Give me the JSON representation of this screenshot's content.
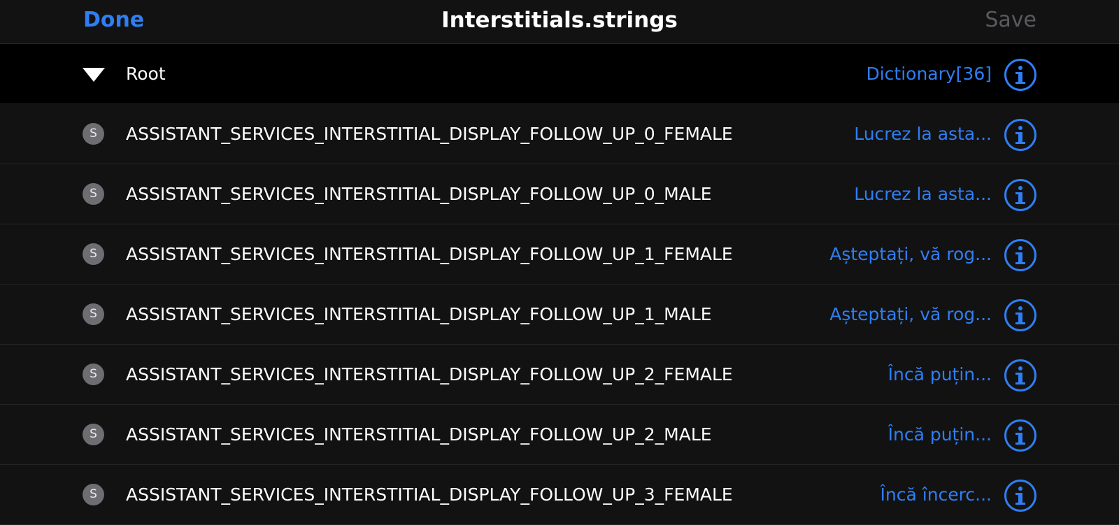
{
  "navbar": {
    "done_label": "Done",
    "title": "Interstitials.strings",
    "save_label": "Save"
  },
  "root": {
    "key": "Root",
    "value": "Dictionary[36]"
  },
  "rows": [
    {
      "type_badge": "S",
      "key": "ASSISTANT_SERVICES_INTERSTITIAL_DISPLAY_FOLLOW_UP_0_FEMALE",
      "value": "Lucrez la asta..."
    },
    {
      "type_badge": "S",
      "key": "ASSISTANT_SERVICES_INTERSTITIAL_DISPLAY_FOLLOW_UP_0_MALE",
      "value": "Lucrez la asta..."
    },
    {
      "type_badge": "S",
      "key": "ASSISTANT_SERVICES_INTERSTITIAL_DISPLAY_FOLLOW_UP_1_FEMALE",
      "value": "Așteptați, vă rog..."
    },
    {
      "type_badge": "S",
      "key": "ASSISTANT_SERVICES_INTERSTITIAL_DISPLAY_FOLLOW_UP_1_MALE",
      "value": "Așteptați, vă rog..."
    },
    {
      "type_badge": "S",
      "key": "ASSISTANT_SERVICES_INTERSTITIAL_DISPLAY_FOLLOW_UP_2_FEMALE",
      "value": "Încă puțin..."
    },
    {
      "type_badge": "S",
      "key": "ASSISTANT_SERVICES_INTERSTITIAL_DISPLAY_FOLLOW_UP_2_MALE",
      "value": "Încă puțin..."
    },
    {
      "type_badge": "S",
      "key": "ASSISTANT_SERVICES_INTERSTITIAL_DISPLAY_FOLLOW_UP_3_FEMALE",
      "value": "Încă încerc..."
    }
  ],
  "colors": {
    "accent": "#2f7ef3",
    "background": "#121213",
    "root_background": "#000000",
    "disabled_text": "#5a5a5e",
    "badge": "#6e6e72"
  },
  "icons": {
    "disclosure": "disclosure-triangle-down-icon",
    "info": "info-circle-icon",
    "string_type": "string-type-badge-icon"
  }
}
